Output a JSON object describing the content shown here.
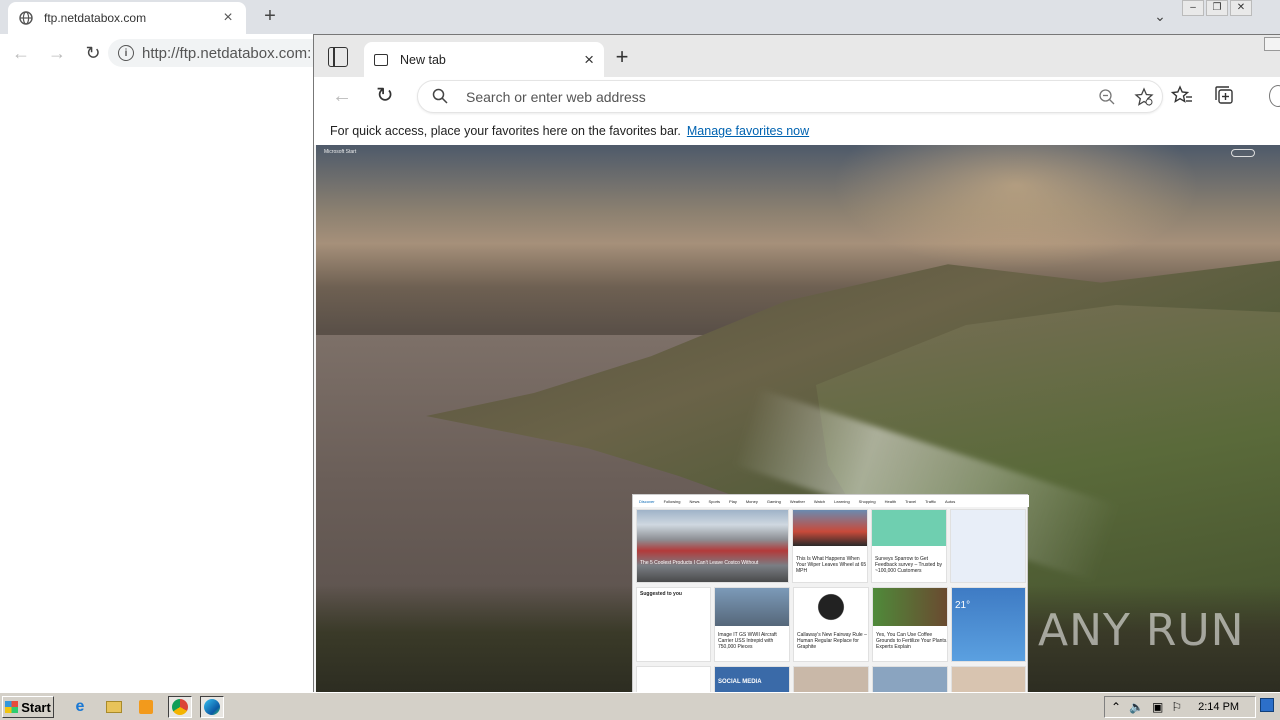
{
  "chrome": {
    "tab_title": "ftp.netdatabox.com",
    "url": "http://ftp.netdatabox.com:"
  },
  "edge": {
    "tab_title": "New tab",
    "search_placeholder": "Search or enter web address",
    "favbar_text": "For quick access, place your favorites here on the favorites bar.",
    "favbar_link": "Manage favorites now",
    "ms_start": "Microsoft Start",
    "feed": {
      "nav": [
        "Discover",
        "Following",
        "News",
        "Sports",
        "Play",
        "Money",
        "Gaming",
        "Weather",
        "Watch",
        "Learning",
        "Shopping",
        "Health",
        "Travel",
        "Traffic",
        "Autos"
      ],
      "cards": [
        {
          "caption": "The 5 Coolest Products I Can't Leave Costco Without"
        },
        {
          "caption": "This Is What Happens When Your Wiper Leaves Wheel at 65 MPH"
        },
        {
          "caption": "Surveys Sparrow to Get Feedback survey – Trusted by ~100,000 Customers"
        },
        {
          "caption": "Image IT GS WWII Aircraft Carrier USS Intrepid with 750,000 Pieces"
        },
        {
          "caption": "Callaway's New Fairway Rule – Human Regular Replace for Graphite"
        },
        {
          "caption": "Yes, You Can Use Coffee Grounds to Fertilize Your Plants. Experts Explain"
        }
      ],
      "weather": {
        "temp": "21°"
      },
      "suggested_title": "Suggested to you",
      "social_tile": "SOCIAL MEDIA"
    }
  },
  "watermark": "ANY RUN",
  "taskbar": {
    "start_label": "Start",
    "clock": "2:14 PM"
  }
}
